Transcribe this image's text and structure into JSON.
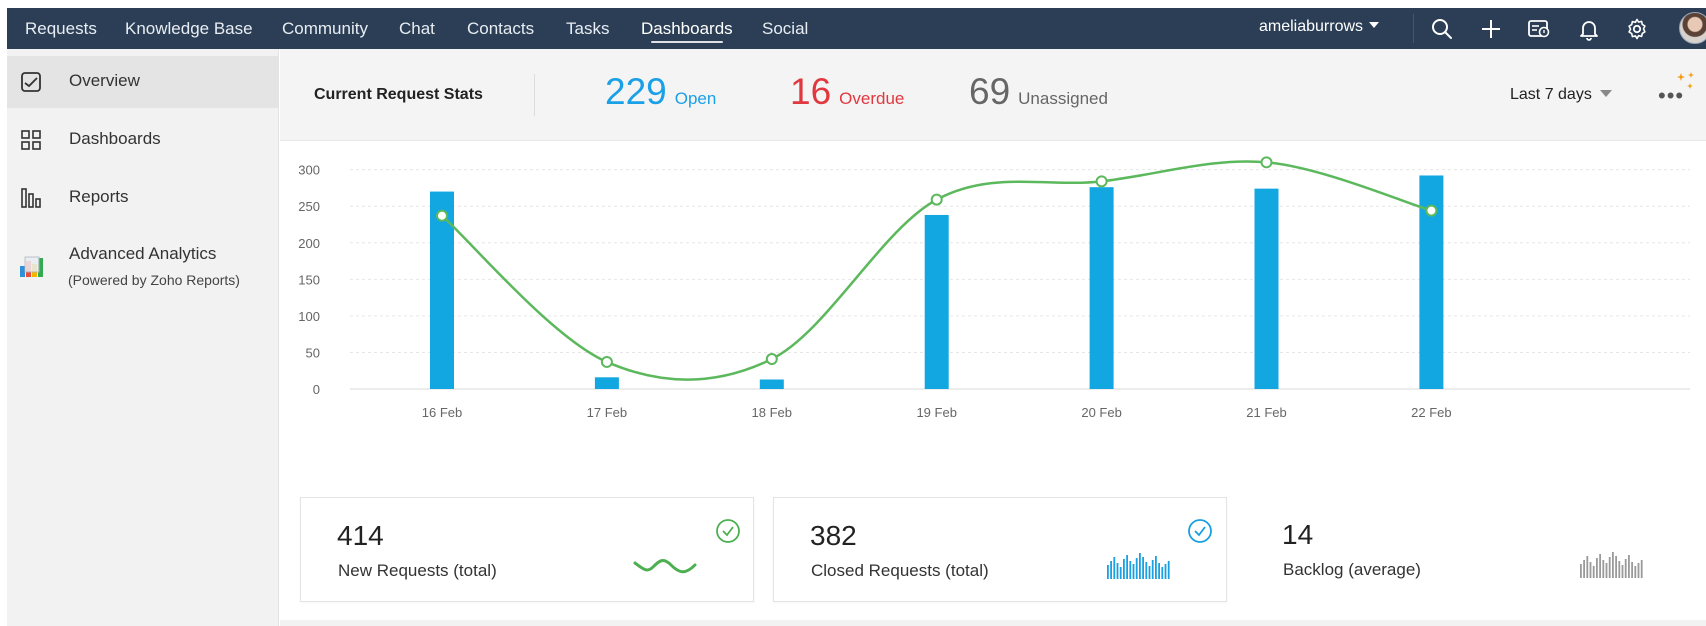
{
  "nav": {
    "items": [
      "Requests",
      "Knowledge Base",
      "Community",
      "Chat",
      "Contacts",
      "Tasks",
      "Dashboards",
      "Social"
    ],
    "active": "Dashboards",
    "user": "ameliaburrows",
    "icons": [
      "search-icon",
      "plus-icon",
      "ticket-icon",
      "bell-icon",
      "gear-icon"
    ]
  },
  "sidebar": {
    "items": [
      {
        "label": "Overview",
        "icon": "overview-icon"
      },
      {
        "label": "Dashboards",
        "icon": "grid-icon"
      },
      {
        "label": "Reports",
        "icon": "bar-report-icon"
      },
      {
        "label": "Advanced Analytics",
        "sub": "(Powered by Zoho Reports)",
        "icon": "analytics-icon"
      }
    ]
  },
  "stats": {
    "title": "Current Request Stats",
    "open": {
      "value": "229",
      "label": "Open",
      "color": "#1aa0e6"
    },
    "overdue": {
      "value": "16",
      "label": "Overdue",
      "color": "#e0383e"
    },
    "unassigned": {
      "value": "69",
      "label": "Unassigned",
      "color": "#666666"
    },
    "range": "Last 7 days"
  },
  "chart_data": {
    "type": "bar",
    "categories": [
      "16 Feb",
      "17 Feb",
      "18 Feb",
      "19 Feb",
      "20 Feb",
      "21 Feb",
      "22 Feb"
    ],
    "series": [
      {
        "type": "bar",
        "values": [
          270,
          16,
          13,
          238,
          276,
          274,
          292
        ],
        "color": "#13a7e2"
      },
      {
        "type": "line",
        "values": [
          237,
          37,
          41,
          259,
          284,
          310,
          244
        ],
        "color": "#5cb85c"
      }
    ],
    "yticks": [
      0,
      50,
      100,
      150,
      200,
      250,
      300
    ],
    "ylim": [
      0,
      320
    ],
    "grid": true
  },
  "cards": [
    {
      "value": "414",
      "label": "New Requests (total)",
      "check_color": "#4caf50",
      "spark_color": "#4caf50"
    },
    {
      "value": "382",
      "label": "Closed Requests (total)",
      "check_color": "#1a9fe0",
      "spark_color": "#1a9fe0"
    },
    {
      "value": "14",
      "label": "Backlog (average)",
      "spark_color": "#9a9a9a"
    }
  ]
}
